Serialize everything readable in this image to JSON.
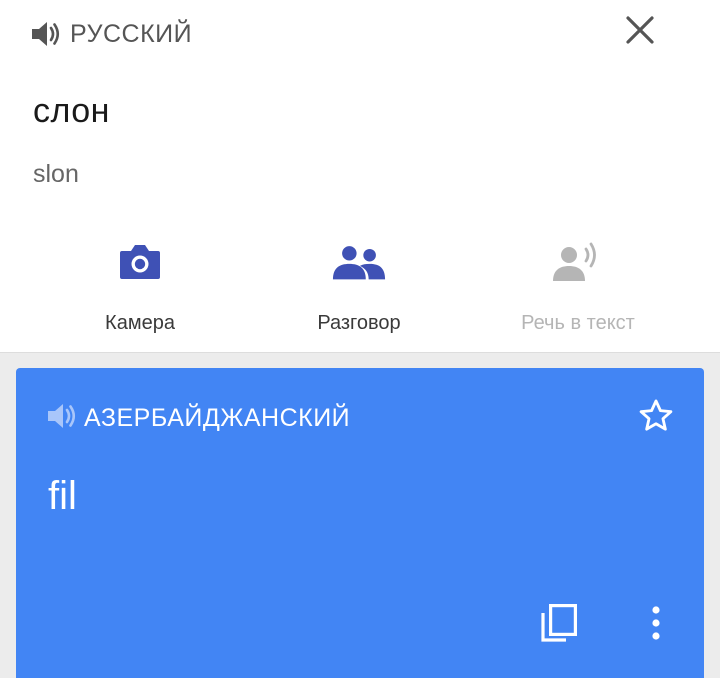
{
  "source": {
    "language": "РУССКИЙ",
    "text": "слон",
    "transliteration": "slon",
    "speaker_icon": "volume-icon",
    "close_icon": "close-icon"
  },
  "tools": [
    {
      "label": "Камера",
      "icon": "camera-icon",
      "enabled": true
    },
    {
      "label": "Разговор",
      "icon": "people-icon",
      "enabled": true
    },
    {
      "label": "Речь в текст",
      "icon": "speech-to-text-icon",
      "enabled": false
    }
  ],
  "result": {
    "language": "АЗЕРБАЙДЖАНСКИЙ",
    "text": "fil",
    "speaker_icon": "volume-icon",
    "star_icon": "star-outline-icon",
    "copy_icon": "copy-icon",
    "more_icon": "more-vert-icon"
  },
  "colors": {
    "accent": "#4285f4",
    "tool_icon": "#3f51b5",
    "disabled": "#b5b5b5"
  }
}
